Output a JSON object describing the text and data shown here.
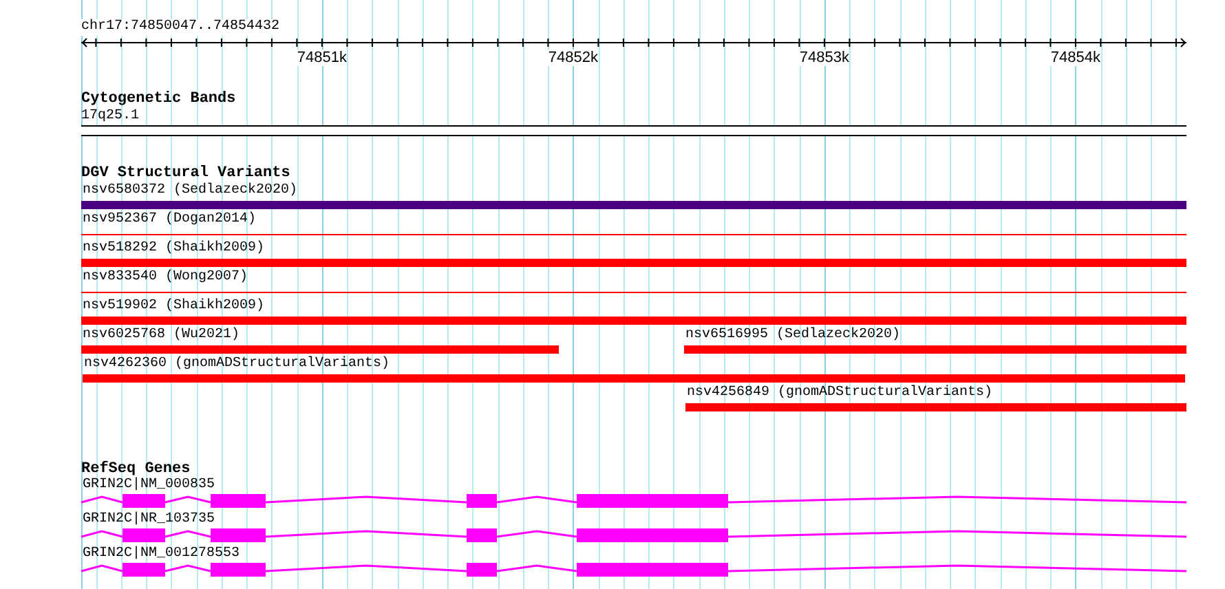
{
  "ruler": {
    "location": "chr17:74850047..74854432",
    "tick_labels": [
      "74851k",
      "74852k",
      "74853k",
      "74854k"
    ]
  },
  "cytogenetic_bands": {
    "title": "Cytogenetic Bands",
    "bands": [
      {
        "label": "17q25.1"
      }
    ]
  },
  "dgv_structural_variants": {
    "title": "DGV Structural Variants",
    "lanes": [
      {
        "features": [
          {
            "label": "nsv6580372 (Sedlazeck2020)",
            "kind": "thick",
            "color": "#4b0082"
          }
        ]
      },
      {
        "features": [
          {
            "label": "nsv952367 (Dogan2014)",
            "kind": "thin",
            "color": "#ff0000"
          }
        ]
      },
      {
        "features": [
          {
            "label": "nsv518292 (Shaikh2009)",
            "kind": "thick",
            "color": "#ff0000"
          }
        ]
      },
      {
        "features": [
          {
            "label": "nsv833540 (Wong2007)",
            "kind": "thin",
            "color": "#ff0000"
          }
        ]
      },
      {
        "features": [
          {
            "label": "nsv519902 (Shaikh2009)",
            "kind": "thick",
            "color": "#ff0000"
          }
        ]
      },
      {
        "features": [
          {
            "label": "nsv6025768 (Wu2021)",
            "kind": "thick",
            "color": "#ff0000"
          },
          {
            "label": "nsv6516995 (Sedlazeck2020)",
            "kind": "thick",
            "color": "#ff0000"
          }
        ]
      },
      {
        "features": [
          {
            "label": "nsv4262360 (gnomADStructuralVariants)",
            "kind": "thick",
            "color": "#ff0000"
          }
        ]
      },
      {
        "features": [
          {
            "label": "nsv4256849 (gnomADStructuralVariants)",
            "kind": "thick",
            "color": "#ff0000"
          }
        ]
      }
    ]
  },
  "refseq_genes": {
    "title": "RefSeq Genes",
    "genes": [
      {
        "label": "GRIN2C|NM_000835"
      },
      {
        "label": "GRIN2C|NR_103735"
      },
      {
        "label": "GRIN2C|NM_001278553"
      }
    ]
  }
}
